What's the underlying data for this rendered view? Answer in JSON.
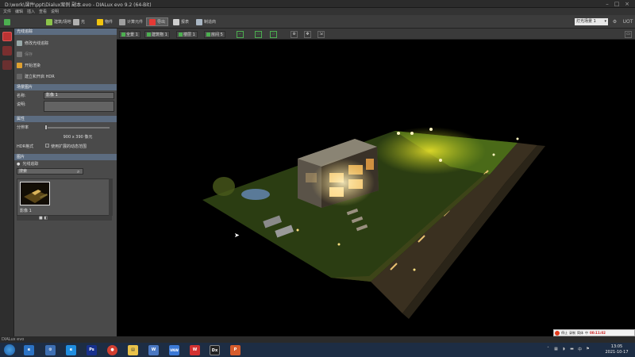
{
  "window": {
    "title": "D:\\work\\课件\\ppt\\Dialux案例 副本.evo - DIALux evo 9.2 (64-Bit)",
    "minimize": "–",
    "maximize": "□",
    "close": "×"
  },
  "menu": [
    "文件",
    "编辑",
    "插入",
    "查看",
    "说明"
  ],
  "toolbar": {
    "buttons": [
      {
        "label": "建筑/场地",
        "icon": "site-icon"
      },
      {
        "label": "光",
        "icon": "light-icon"
      },
      {
        "label": "物件",
        "icon": "object-icon"
      },
      {
        "label": "计算元件",
        "icon": "calc-icon"
      },
      {
        "label": "导出",
        "icon": "export-icon"
      },
      {
        "label": "报表",
        "icon": "report-icon"
      },
      {
        "label": "制造商",
        "icon": "manufacturer-icon"
      }
    ],
    "active_index": 4,
    "scene_select": "灯光场景 1",
    "right_label": "UOT"
  },
  "panel": {
    "section1_title": "光线追踪",
    "items": [
      {
        "label": "修改光线追踪",
        "icon": "raytrace-icon"
      },
      {
        "label": "保存",
        "icon": "save-icon"
      },
      {
        "label": "开始渲染",
        "icon": "render-icon"
      },
      {
        "label": "建立和开启 HDR",
        "icon": "hdr-icon"
      }
    ],
    "properties_title": "场景图片",
    "name_label": "名称:",
    "name_value": "影像 1",
    "desc_label": "说明:",
    "desc_value": "",
    "attributes_title": "属性",
    "resolution_label": "分辨率",
    "resolution_value": "900 x 390 像元",
    "hdr_label": "HDR格式",
    "hdr_checkbox_label": "使用扩展的动态范围",
    "images_title": "图片",
    "images_subtitle": "光线追踪",
    "search_placeholder": "搜索",
    "thumb_label": "影像 1"
  },
  "viewport_toolbar": {
    "buttons": [
      "全景 1",
      "建筑物 1",
      "楼层 1",
      "房间 5"
    ],
    "view_icons": [
      "3d-view-icon",
      "plan-view-icon",
      "elevation-view-icon"
    ]
  },
  "ime": {
    "stop": "停止",
    "record": "录制",
    "state": "简体",
    "lang": "中",
    "time_badge": "00:11:02"
  },
  "statusbar": {
    "text": "DIALux evo"
  },
  "taskbar": {
    "apps": [
      {
        "name": "ie",
        "label": "e",
        "color": "#2b73c5"
      },
      {
        "name": "settings",
        "label": "⚙",
        "color": "#3d6fb3"
      },
      {
        "name": "ie2",
        "label": "e",
        "color": "#1f8de0"
      },
      {
        "name": "photoshop",
        "label": "Ps",
        "color": "#16308d"
      },
      {
        "name": "chrome",
        "label": "●",
        "color": "#d23f31"
      },
      {
        "name": "explorer",
        "label": "▤",
        "color": "#e9c24a"
      },
      {
        "name": "app7",
        "label": "W",
        "color": "#4a78c2"
      },
      {
        "name": "vnw",
        "label": "VNW",
        "color": "#3b79d6"
      },
      {
        "name": "wps",
        "label": "W",
        "color": "#d23131"
      },
      {
        "name": "dialux",
        "label": "Dx",
        "color": "#222222"
      },
      {
        "name": "ppt",
        "label": "P",
        "color": "#d65c2c"
      }
    ],
    "time": "13:05",
    "date": "2021-10-17"
  }
}
